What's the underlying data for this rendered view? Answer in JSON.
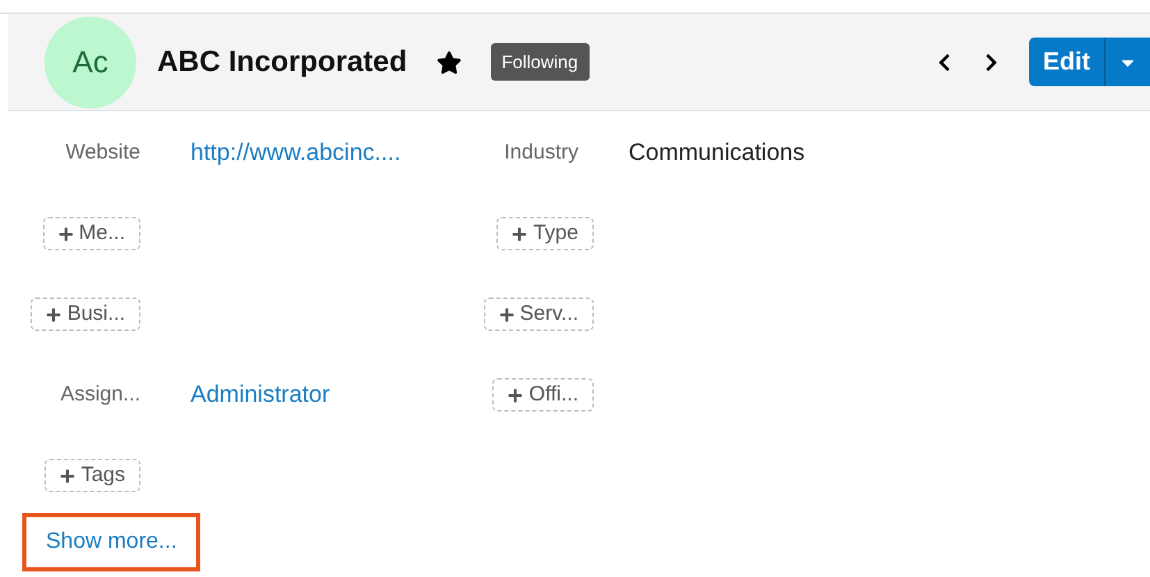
{
  "header": {
    "avatar": "Ac",
    "title": "ABC Incorporated",
    "favorite": true,
    "badge": "Following",
    "edit_button": "Edit"
  },
  "rows": [
    {
      "left": {
        "kind": "field",
        "label": "Website",
        "value": "http://www.abcinc....",
        "link": true
      },
      "right": {
        "kind": "field",
        "label": "Industry",
        "value": "Communications",
        "link": false
      }
    },
    {
      "left": {
        "kind": "add",
        "label": "Me..."
      },
      "right": {
        "kind": "add",
        "label": "Type"
      }
    },
    {
      "left": {
        "kind": "add",
        "label": "Busi..."
      },
      "right": {
        "kind": "add",
        "label": "Serv..."
      }
    },
    {
      "left": {
        "kind": "field",
        "label": "Assign...",
        "value": "Administrator",
        "link": true
      },
      "right": {
        "kind": "add",
        "label": "Offi..."
      }
    },
    {
      "left": {
        "kind": "add",
        "label": "Tags"
      }
    }
  ],
  "show_more": {
    "label": "Show more...",
    "highlighted": true
  }
}
